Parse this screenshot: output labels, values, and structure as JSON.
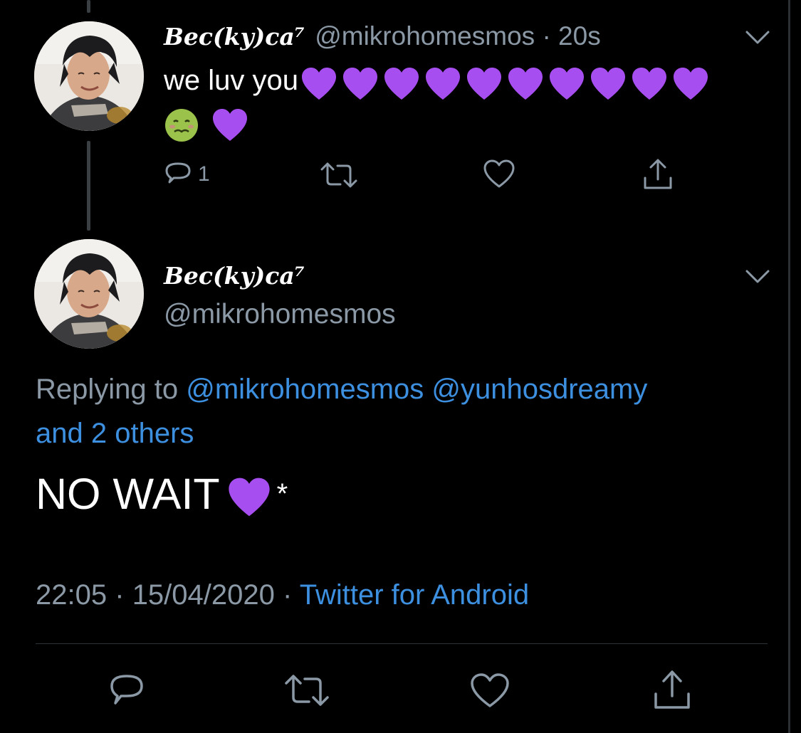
{
  "tweet1": {
    "display_name": "Bec(ky)ca⁷",
    "handle": "@mikrohomesmos",
    "separator": "·",
    "time_ago": "20s",
    "text": "we luv you",
    "emoji_line1": [
      "purple-heart",
      "purple-heart",
      "purple-heart",
      "purple-heart",
      "purple-heart",
      "purple-heart",
      "purple-heart",
      "purple-heart",
      "purple-heart",
      "purple-heart"
    ],
    "emoji_line2": [
      "nauseated-face",
      "purple-heart"
    ],
    "reply_count": "1"
  },
  "tweet2": {
    "display_name": "Bec(ky)ca⁷",
    "handle": "@mikrohomesmos",
    "replying_prefix": "Replying to",
    "replying_users": [
      "@mikrohomesmos",
      "@yunhosdreamy"
    ],
    "replying_others": "and 2 others",
    "text_before": "NO WAIT",
    "text_after": "*",
    "time": "22:05",
    "date": "15/04/2020",
    "sep1": "·",
    "sep2": "·",
    "source": "Twitter for Android"
  },
  "colors": {
    "background": "#000000",
    "secondary_text": "#8b98a5",
    "link": "#3d8fe0",
    "purple_heart": "#a64ef0"
  },
  "icons": {
    "reply": "reply-icon",
    "retweet": "retweet-icon",
    "like": "like-icon",
    "share": "share-icon",
    "caret": "chevron-down-icon"
  }
}
